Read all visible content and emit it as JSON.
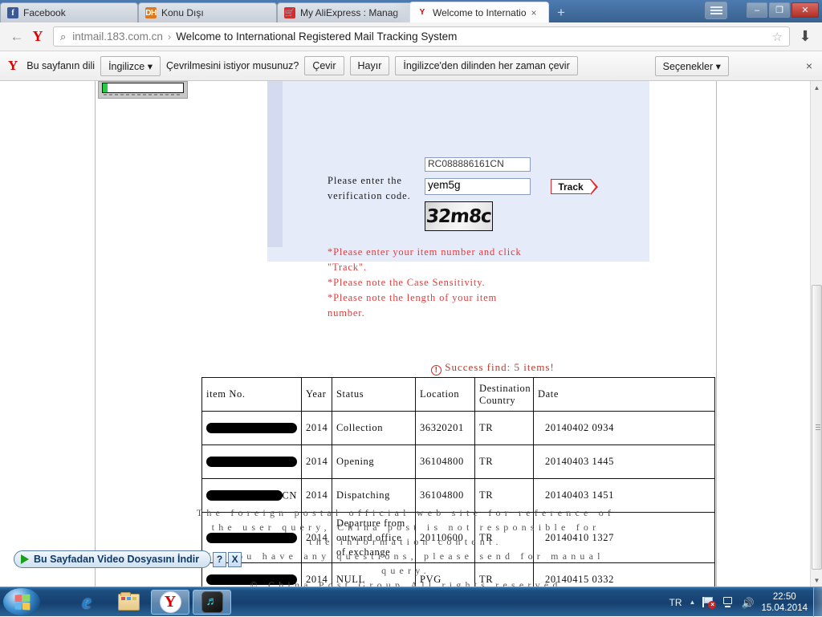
{
  "browser": {
    "tabs": [
      {
        "label": "Facebook",
        "favicon": "facebook-icon",
        "active": false
      },
      {
        "label": "Konu Dışı",
        "favicon": "dh-icon",
        "active": false
      },
      {
        "label": "My AliExpress : Manag",
        "favicon": "aliexpress-cart-icon",
        "active": false
      },
      {
        "label": "Welcome to Internatio",
        "favicon": "yandex-icon",
        "active": true
      }
    ],
    "new_tab_glyph": "+",
    "tab_close_glyph": "×",
    "window_controls": {
      "minimize": "–",
      "restore": "❐",
      "close": "✕"
    },
    "nav": {
      "back_glyph": "←",
      "brand_glyph": "Y",
      "search_glyph": "⌕",
      "url_host": "intmail.183.com.cn",
      "url_separator": "›",
      "page_title": "Welcome to International Registered Mail Tracking System",
      "bookmark_glyph": "☆",
      "download_glyph": "⬇"
    },
    "translate_bar": {
      "brand_glyph": "Y",
      "prompt": "Bu sayfanın dili",
      "language_select": "İngilizce",
      "select_caret": "▾",
      "question": "Çevrilmesini istiyor musunuz?",
      "translate_button": "Çevir",
      "no_button": "Hayır",
      "always_button": "İngilizce'den dilinden her zaman çevir",
      "options_button": "Seçenekler",
      "close_glyph": "×"
    }
  },
  "page": {
    "form": {
      "item_number_value": "RC088886161CN",
      "verification_label": "Please enter the verification code.",
      "verification_value": "yem5g",
      "captcha_text": "32m8c",
      "track_button": "Track",
      "notes": "*Please enter your item number and click \"Track\".\n*Please note the Case Sensitivity.\n*Please note the length of your item number."
    },
    "result": {
      "status_icon": "exclamation-circle-icon",
      "status_text": "Success find: 5 items!",
      "columns": [
        "item No.",
        "Year",
        "Status",
        "Location",
        "Destination Country",
        "Date"
      ],
      "rows": [
        {
          "item_no": "",
          "redacted": true,
          "year": "2014",
          "status": "Collection",
          "location": "36320201",
          "country": "TR",
          "date": "20140402 0934"
        },
        {
          "item_no": "",
          "redacted": true,
          "year": "2014",
          "status": "Opening",
          "location": "36104800",
          "country": "TR",
          "date": "20140403 1445"
        },
        {
          "item_no": "CN",
          "redacted": true,
          "year": "2014",
          "status": "Dispatching",
          "location": "36104800",
          "country": "TR",
          "date": "20140403 1451"
        },
        {
          "item_no": "",
          "redacted": true,
          "year": "2014",
          "status": "Departure from outward office of exchange",
          "location": "20110600",
          "country": "TR",
          "date": "20140410 1327"
        },
        {
          "item_no": "",
          "redacted": true,
          "year": "2014",
          "status": "NULL",
          "location": "PVG",
          "country": "TR",
          "date": "20140415 0332"
        }
      ]
    },
    "footer": {
      "line1": "The foreign postal official web site for reference of",
      "line2": "the user query, China post is not responsible for",
      "line3": "the information content.",
      "line4": "If you have any questions, please send for manual",
      "line5": "query.",
      "line6": "© China Post Group.All rights reserved"
    },
    "download_popup": {
      "label": "Bu Sayfadan Video Dosyasını İndir",
      "help_glyph": "?",
      "close_glyph": "X"
    },
    "scrollbar": {
      "up_glyph": "▲",
      "down_glyph": "▼"
    }
  },
  "taskbar": {
    "start_label": "start-orb",
    "buttons": [
      {
        "name": "internet-explorer",
        "glyph": "e",
        "active": false
      },
      {
        "name": "windows-explorer",
        "glyph": "",
        "active": false
      },
      {
        "name": "yandex-browser",
        "glyph": "Y",
        "active": true
      },
      {
        "name": "sound-app",
        "glyph": "♬",
        "active": false
      }
    ],
    "tray": {
      "language": "TR",
      "caret": "▲",
      "flag_icon": "flag-error-icon",
      "network_icon": "network-icon",
      "volume_icon": "🔊",
      "time": "22:50",
      "date": "15.04.2014"
    }
  },
  "colors": {
    "accent_red": "#e02b2b",
    "panel_bg": "#e6ebfa",
    "taskbar_blue": "#15406f"
  }
}
